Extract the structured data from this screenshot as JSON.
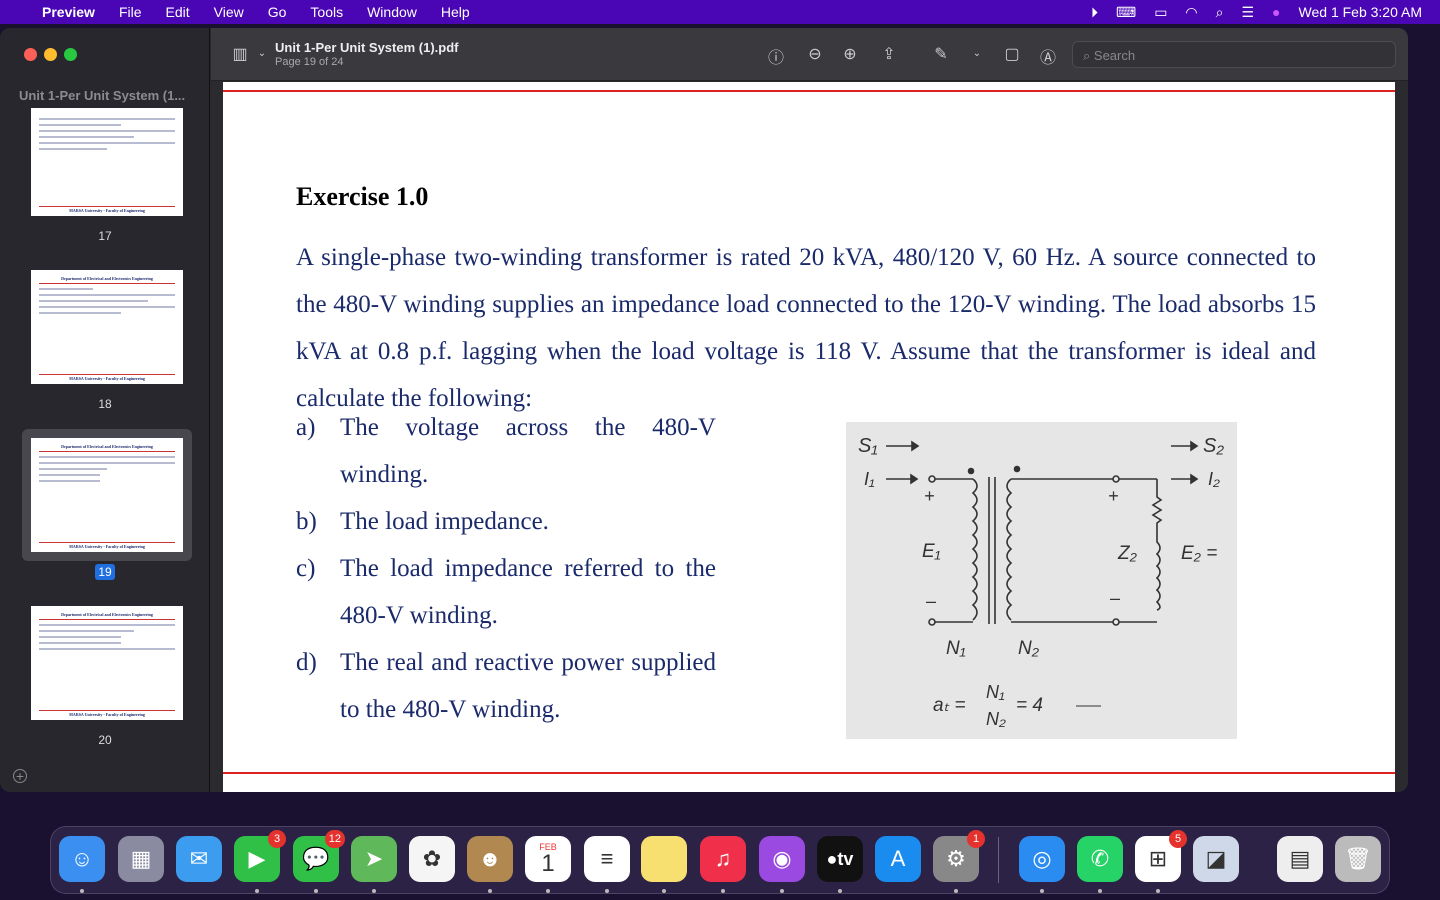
{
  "menubar": {
    "app": "Preview",
    "items": [
      "File",
      "Edit",
      "View",
      "Go",
      "Tools",
      "Window",
      "Help"
    ],
    "clock": "Wed 1 Feb  3:20 AM"
  },
  "sidebar": {
    "title": "Unit 1-Per Unit System (1...",
    "pages": [
      {
        "num": "17",
        "header": ""
      },
      {
        "num": "18",
        "header": "Department of Electrical and Electronics Engineering"
      },
      {
        "num": "19",
        "header": "Department of Electrical and Electronics Engineering"
      },
      {
        "num": "20",
        "header": "Department of Electrical and Electronics Engineering"
      }
    ],
    "footer": "MARSA University - Faculty of Engineering",
    "selected": "19"
  },
  "toolbar": {
    "title": "Unit 1-Per Unit System (1).pdf",
    "subtitle": "Page 19 of 24",
    "search_placeholder": "Search"
  },
  "document": {
    "heading": "Exercise 1.0",
    "paragraph": "A single-phase two-winding transformer is rated 20 kVA, 480/120 V, 60 Hz. A source connected to the 480-V winding supplies an impedance load connected to the 120-V winding. The load absorbs 15 kVA at 0.8 p.f. lagging when the load voltage is 118 V. Assume that the transformer is ideal and calculate the following:",
    "questions": [
      {
        "label": "a)",
        "text": "The voltage across the 480-V winding."
      },
      {
        "label": "b)",
        "text": "The load impedance."
      },
      {
        "label": "c)",
        "text": "The load impedance referred to the 480-V winding."
      },
      {
        "label": "d)",
        "text": "The real and reactive power supplied to the 480-V winding."
      }
    ],
    "figure": {
      "s1": "S₁",
      "s2": "S₂",
      "i1": "I₁",
      "i2": "I₂",
      "e1": "E₁",
      "e2": "E₂ =",
      "z2": "Z₂",
      "n1": "N₁",
      "n2": "N₂",
      "ratio_lhs": "aₜ =",
      "ratio_num": "N₁",
      "ratio_den": "N₂",
      "ratio_rhs": "= 4"
    }
  },
  "dock": {
    "apps": [
      {
        "name": "Finder",
        "badge": ""
      },
      {
        "name": "Launchpad",
        "badge": ""
      },
      {
        "name": "Mail",
        "badge": ""
      },
      {
        "name": "FaceTime",
        "badge": "3"
      },
      {
        "name": "Messages",
        "badge": "12"
      },
      {
        "name": "Maps",
        "badge": ""
      },
      {
        "name": "Photos",
        "badge": ""
      },
      {
        "name": "Contacts",
        "badge": ""
      },
      {
        "name": "Calendar",
        "badge": "",
        "month": "FEB",
        "day": "1"
      },
      {
        "name": "Reminders",
        "badge": ""
      },
      {
        "name": "Notes",
        "badge": ""
      },
      {
        "name": "Music",
        "badge": ""
      },
      {
        "name": "Podcasts",
        "badge": ""
      },
      {
        "name": "TV",
        "badge": "",
        "label": "tv"
      },
      {
        "name": "App Store",
        "badge": ""
      },
      {
        "name": "System Preferences",
        "badge": "1"
      },
      {
        "name": "Safari",
        "badge": ""
      },
      {
        "name": "WhatsApp",
        "badge": ""
      },
      {
        "name": "Microsoft",
        "badge": "5"
      },
      {
        "name": "Preview",
        "badge": ""
      },
      {
        "name": "Documents",
        "badge": ""
      },
      {
        "name": "Trash",
        "badge": ""
      }
    ]
  },
  "colors": {
    "menubar": "#4a06b4",
    "accent": "#1f6fe0",
    "rule": "#d22222",
    "text": "#1a2a6b"
  }
}
